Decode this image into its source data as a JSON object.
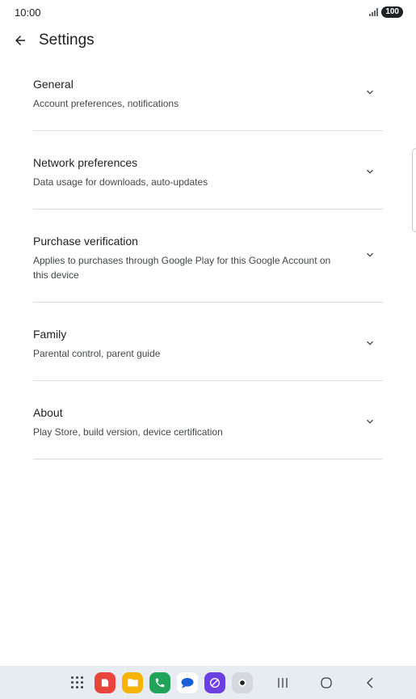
{
  "status_bar": {
    "time": "10:00",
    "battery": "100"
  },
  "header": {
    "title": "Settings",
    "back_icon": "arrow-back-icon"
  },
  "settings": [
    {
      "title": "General",
      "subtitle": "Account preferences, notifications"
    },
    {
      "title": "Network preferences",
      "subtitle": "Data usage for downloads, auto-updates"
    },
    {
      "title": "Purchase verification",
      "subtitle": "Applies to purchases through Google Play for this Google Account on this device"
    },
    {
      "title": "Family",
      "subtitle": "Parental control, parent guide"
    },
    {
      "title": "About",
      "subtitle": "Play Store, build version, device certification"
    }
  ],
  "taskbar": {
    "apps": [
      "apps-grid-icon",
      "notes-app-icon",
      "files-app-icon",
      "phone-app-icon",
      "messages-app-icon",
      "internet-app-icon",
      "camera-app-icon"
    ],
    "nav": [
      "recents-icon",
      "home-icon",
      "back-icon"
    ]
  },
  "colors": {
    "divider": "#dadce0",
    "taskbar_bg": "#e7ecf3",
    "accent_green": "#21a35a",
    "accent_red": "#e8453c"
  }
}
